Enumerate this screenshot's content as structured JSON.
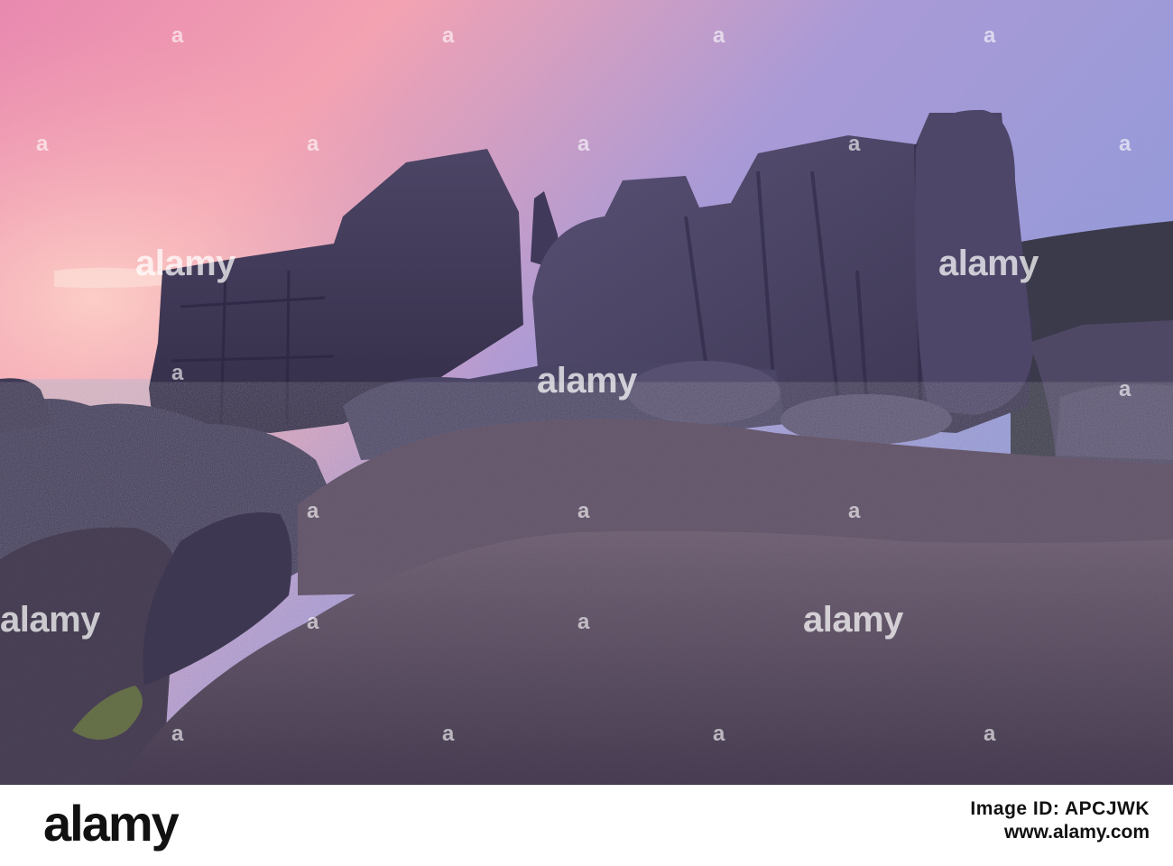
{
  "photo": {
    "subject": "granite rock outcrops silhouetted against a pink and blue twilight sky",
    "colors": {
      "sky_top": "#8f93d6",
      "sky_pink": "#f39bb0",
      "rock_dark": "#3f3a5a",
      "rock_mid": "#5a5270",
      "foreground_rock": "#6b5b6e"
    }
  },
  "watermark": {
    "logo_text": "alamy",
    "mark_glyph": "a"
  },
  "footer": {
    "brand": "alamy",
    "image_id_label": "Image ID: APCJWK",
    "url": "www.alamy.com"
  }
}
